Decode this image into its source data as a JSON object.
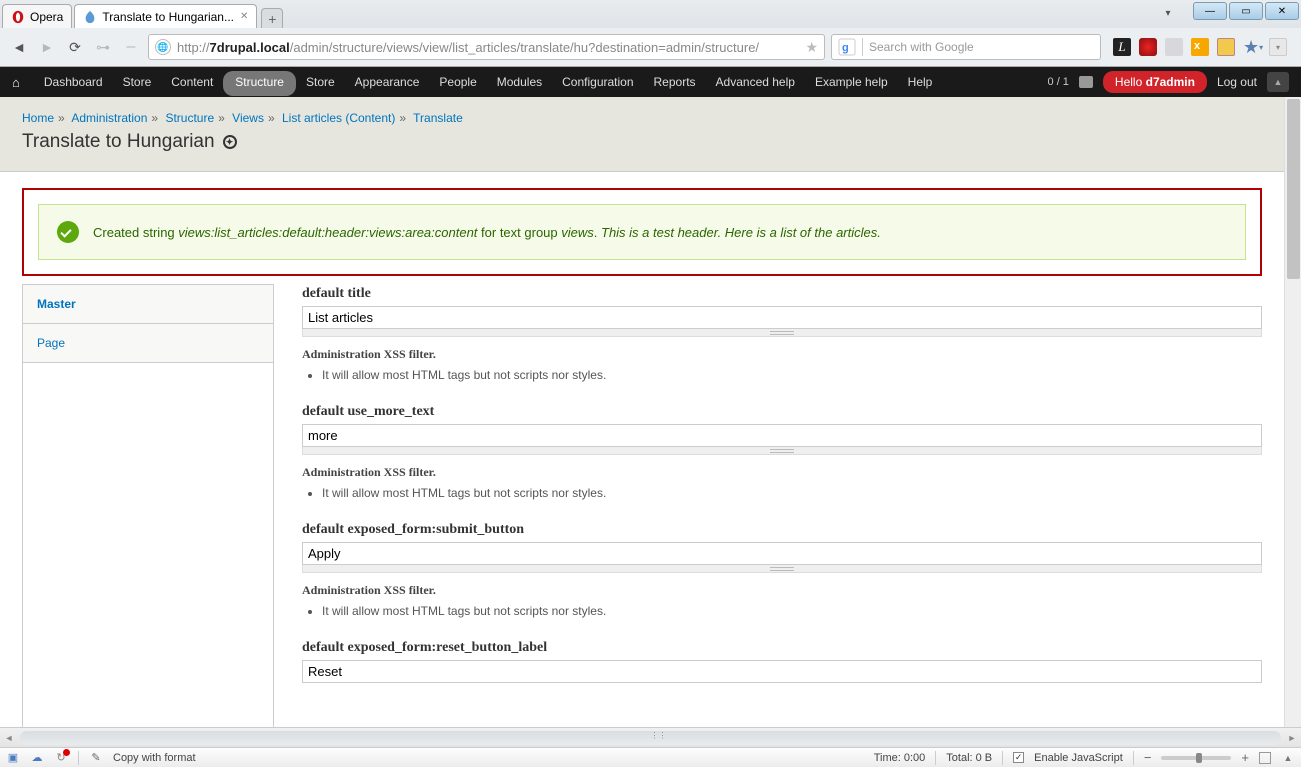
{
  "browser": {
    "opera_tab": "Opera",
    "page_tab": "Translate to Hungarian...",
    "url_prefix": "http://",
    "url_domain": "7drupal.local",
    "url_path": "/admin/structure/views/view/list_articles/translate/hu?destination=admin/structure/",
    "search_placeholder": "Search with Google"
  },
  "admin_menu": [
    "Dashboard",
    "Store",
    "Content",
    "Structure",
    "Store",
    "Appearance",
    "People",
    "Modules",
    "Configuration",
    "Reports",
    "Advanced help",
    "Example help",
    "Help"
  ],
  "admin_right": {
    "count": "0 / 1",
    "hello_prefix": "Hello ",
    "hello_user": "d7admin",
    "logout": "Log out"
  },
  "breadcrumb": [
    {
      "label": "Home"
    },
    {
      "label": "Administration"
    },
    {
      "label": "Structure"
    },
    {
      "label": "Views"
    },
    {
      "label": "List articles (Content)"
    },
    {
      "label": "Translate"
    }
  ],
  "page_title": "Translate to Hungarian",
  "status": {
    "pre": "Created string ",
    "em1": "views:list_articles:default:header:views:area:content",
    "mid": " for text group ",
    "em2": "views",
    "post": ". ",
    "em3": "This is a test header. Here is a list of the articles."
  },
  "tabs": [
    "Master",
    "Page"
  ],
  "fields": [
    {
      "label": "default title",
      "value": "List articles"
    },
    {
      "label": "default use_more_text",
      "value": "more"
    },
    {
      "label": "default exposed_form:submit_button",
      "value": "Apply"
    },
    {
      "label": "default exposed_form:reset_button_label",
      "value": "Reset"
    }
  ],
  "xss": {
    "label": "Administration XSS filter.",
    "item": "It will allow most HTML tags but not scripts nor styles."
  },
  "statusbar": {
    "copy": "Copy with format",
    "time": "Time:   0:00",
    "total": "Total:   0 B",
    "js": "Enable JavaScript"
  }
}
